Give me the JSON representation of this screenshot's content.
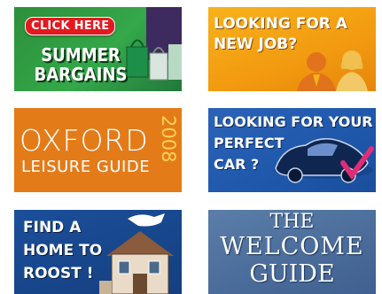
{
  "tiles": {
    "summer": {
      "badge": "CLICK HERE",
      "line1": "SUMMER",
      "line2": "BARGAINS"
    },
    "job": {
      "line1": "LOOKING FOR A",
      "line2": "NEW JOB?"
    },
    "oxford": {
      "title": "OXFORD",
      "subtitle": "LEISURE GUIDE",
      "year": "2008"
    },
    "car": {
      "line1": "LOOKING FOR YOUR",
      "line2": "PERFECT",
      "line3": "CAR ?"
    },
    "home": {
      "line1": "FIND A",
      "line2": "HOME TO",
      "line3": "ROOST !"
    },
    "welcome": {
      "line1": "THE",
      "line2": "WELCOME",
      "line3": "GUIDE"
    }
  },
  "colors": {
    "summer_bg": "#34a84a",
    "job_bg": "#f29a10",
    "oxford_bg": "#e47b19",
    "car_bg": "#1d55a8",
    "home_bg": "#153f7f",
    "welcome_bg": "#4a6b98",
    "badge_red": "#e3191f"
  }
}
